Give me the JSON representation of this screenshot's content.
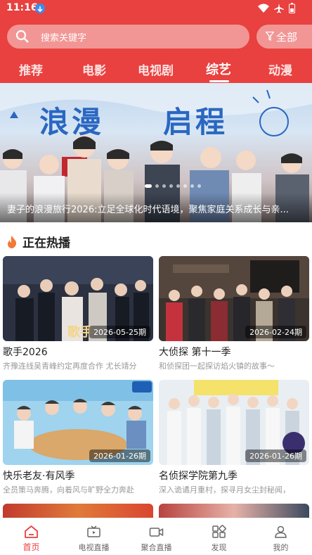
{
  "status_bar": {
    "time": "11:16"
  },
  "search": {
    "placeholder": "搜索关键字",
    "icon": "search-icon"
  },
  "filter_button": {
    "label": "全部",
    "icon": "filter-icon"
  },
  "tabs": [
    {
      "label": "推荐"
    },
    {
      "label": "电影"
    },
    {
      "label": "电视剧"
    },
    {
      "label": "综艺",
      "active": true
    },
    {
      "label": "动漫"
    }
  ],
  "banner": {
    "title_left": "浪漫",
    "title_right": "启程",
    "caption": "妻子的浪漫旅行2026:立足全球化时代语境，聚焦家庭关系成长与亲...",
    "slide_count": 8,
    "active_slide": 1
  },
  "hot_section": {
    "title": "正在热播",
    "icon": "flame-icon"
  },
  "cards": [
    {
      "title": "歌手2026",
      "date": "2026-05-25期",
      "desc": "齐豫连线吴青峰约定再度合作 尤长靖分",
      "overlay": "歌手"
    },
    {
      "title": "大侦探 第十一季",
      "date": "2026-02-24期",
      "desc": "和侦探团一起探访焰火镇的故事～"
    },
    {
      "title": "快乐老友·有风季",
      "date": "2026-01-26期",
      "desc": "全员策马奔腾，向着风与旷野全力奔赴"
    },
    {
      "title": "名侦探学院第九季",
      "date": "2026-01-26期",
      "desc": "深入诡谲月重村，探寻月女尘封秘闻，"
    }
  ],
  "bottom_nav": [
    {
      "label": "首页",
      "icon": "home-icon",
      "active": true
    },
    {
      "label": "电视直播",
      "icon": "tv-icon"
    },
    {
      "label": "聚合直播",
      "icon": "video-camera-icon"
    },
    {
      "label": "发现",
      "icon": "discover-icon"
    },
    {
      "label": "我的",
      "icon": "user-icon"
    }
  ],
  "colors": {
    "accent": "#e8413f",
    "banner_title": "#2a67c2"
  }
}
